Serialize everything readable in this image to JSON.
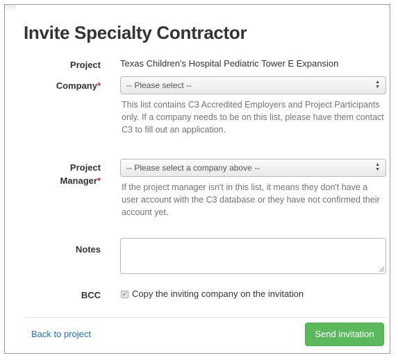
{
  "modal": {
    "title": "Invite Specialty Contractor"
  },
  "project": {
    "label": "Project",
    "value": "Texas Children's Hospital Pediatric Tower E Expansion"
  },
  "company": {
    "label": "Company",
    "required_mark": "*",
    "selected": "-- Please select --",
    "help": "This list contains C3 Accredited Employers and Project Participants only. If a company needs to be on this list, please have them contact C3 to fill out an application."
  },
  "project_manager": {
    "label_line1": "Project",
    "label_line2": "Manager",
    "required_mark": "*",
    "selected": "-- Please select a company above --",
    "help": "If the project manager isn't in this list, it means they don't have a user account with the C3 database or they have not confirmed their account yet."
  },
  "notes": {
    "label": "Notes",
    "value": ""
  },
  "bcc": {
    "label": "BCC",
    "checkbox_label": "Copy the inviting company on the invitation",
    "checked": true
  },
  "footer": {
    "back_link": "Back to project",
    "send_button": "Send invitation"
  },
  "colors": {
    "primary_button": "#5cb85c",
    "link": "#2a6eb3",
    "required": "#c7254e"
  },
  "icons": {
    "select_arrows": "up-down-chevron-icon",
    "checkbox": "checkmark-icon",
    "resize": "resize-grip-icon"
  }
}
